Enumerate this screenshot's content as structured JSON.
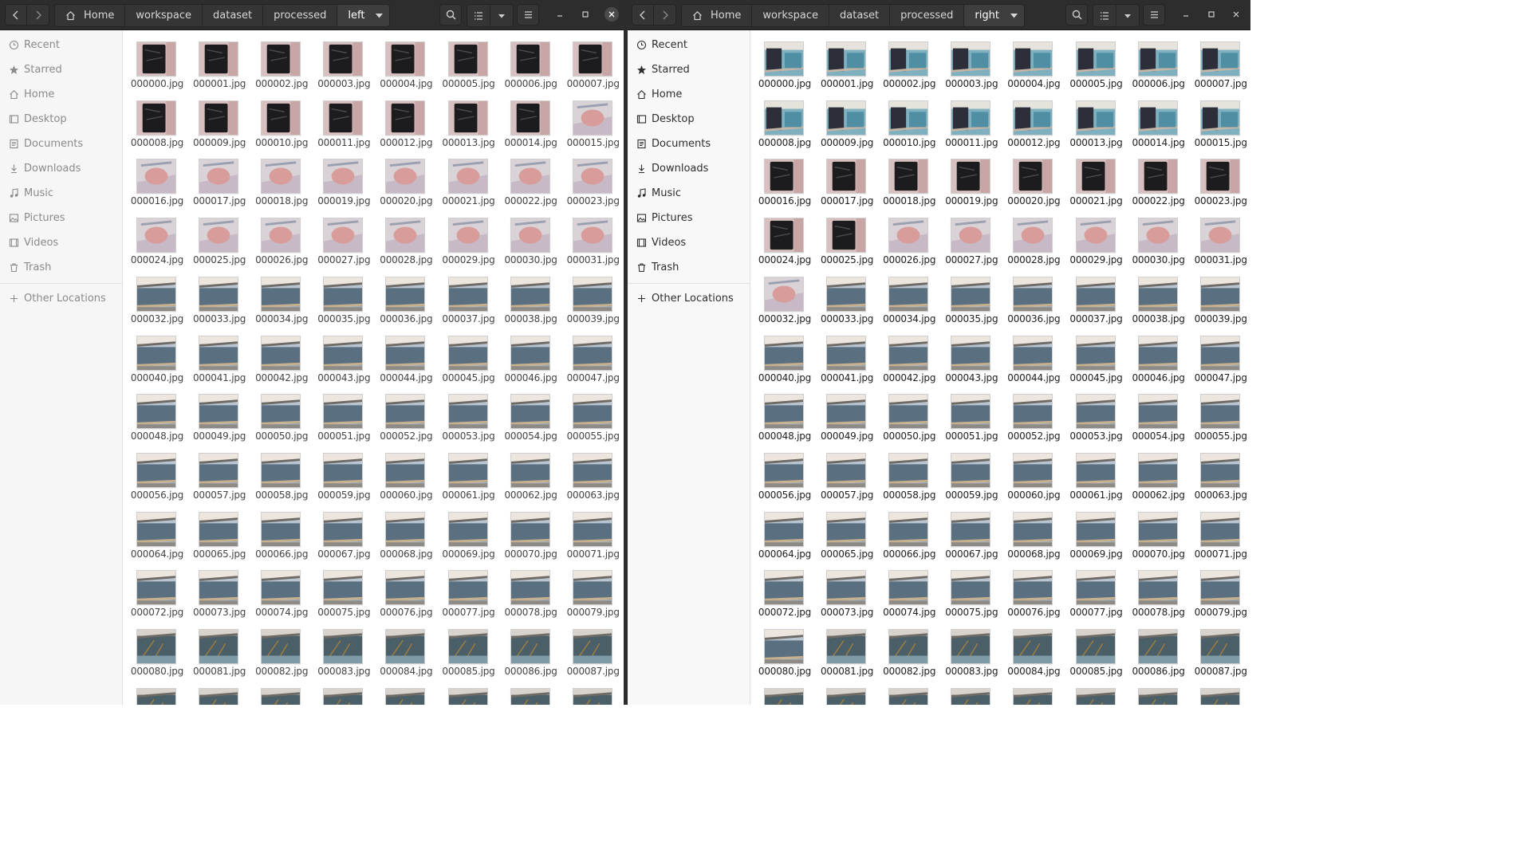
{
  "left_window": {
    "path": [
      "Home",
      "workspace",
      "dataset",
      "processed",
      "left"
    ],
    "sidebar": [
      "Recent",
      "Starred",
      "Home",
      "Desktop",
      "Documents",
      "Downloads",
      "Music",
      "Pictures",
      "Videos",
      "Trash"
    ],
    "other_locations": "Other Locations",
    "thumb_sequence": [
      "dark",
      "dark",
      "dark",
      "dark",
      "dark",
      "dark",
      "dark",
      "dark",
      "dark",
      "dark",
      "dark",
      "dark",
      "dark",
      "dark",
      "dark",
      "pink",
      "pink",
      "pink",
      "pink",
      "pink",
      "pink",
      "pink",
      "pink",
      "pink",
      "pink",
      "pink",
      "pink",
      "pink",
      "pink",
      "pink",
      "pink",
      "pink",
      "bridge",
      "bridge",
      "bridge",
      "bridge",
      "bridge",
      "bridge",
      "bridge",
      "bridge",
      "bridge",
      "bridge",
      "bridge",
      "bridge",
      "bridge",
      "bridge",
      "bridge",
      "bridge",
      "bridge",
      "bridge",
      "bridge",
      "bridge",
      "bridge",
      "bridge",
      "bridge",
      "bridge",
      "bridge",
      "bridge",
      "bridge",
      "bridge",
      "bridge",
      "bridge",
      "bridge",
      "bridge",
      "bridge",
      "bridge",
      "bridge",
      "bridge",
      "bridge",
      "bridge",
      "bridge",
      "bridge",
      "bridge",
      "bridge",
      "bridge",
      "bridge",
      "bridge",
      "bridge",
      "bridge",
      "bridge",
      "dock",
      "dock",
      "dock",
      "dock",
      "dock",
      "dock",
      "dock",
      "dock",
      "dock",
      "dock",
      "dock",
      "dock",
      "dock",
      "dock",
      "dock",
      "dock"
    ],
    "files": [
      "000000.jpg",
      "000001.jpg",
      "000002.jpg",
      "000003.jpg",
      "000004.jpg",
      "000005.jpg",
      "000006.jpg",
      "000007.jpg",
      "000008.jpg",
      "000009.jpg",
      "000010.jpg",
      "000011.jpg",
      "000012.jpg",
      "000013.jpg",
      "000014.jpg",
      "000015.jpg",
      "000016.jpg",
      "000017.jpg",
      "000018.jpg",
      "000019.jpg",
      "000020.jpg",
      "000021.jpg",
      "000022.jpg",
      "000023.jpg",
      "000024.jpg",
      "000025.jpg",
      "000026.jpg",
      "000027.jpg",
      "000028.jpg",
      "000029.jpg",
      "000030.jpg",
      "000031.jpg",
      "000032.jpg",
      "000033.jpg",
      "000034.jpg",
      "000035.jpg",
      "000036.jpg",
      "000037.jpg",
      "000038.jpg",
      "000039.jpg",
      "000040.jpg",
      "000041.jpg",
      "000042.jpg",
      "000043.jpg",
      "000044.jpg",
      "000045.jpg",
      "000046.jpg",
      "000047.jpg",
      "000048.jpg",
      "000049.jpg",
      "000050.jpg",
      "000051.jpg",
      "000052.jpg",
      "000053.jpg",
      "000054.jpg",
      "000055.jpg",
      "000056.jpg",
      "000057.jpg",
      "000058.jpg",
      "000059.jpg",
      "000060.jpg",
      "000061.jpg",
      "000062.jpg",
      "000063.jpg",
      "000064.jpg",
      "000065.jpg",
      "000066.jpg",
      "000067.jpg",
      "000068.jpg",
      "000069.jpg",
      "000070.jpg",
      "000071.jpg",
      "000072.jpg",
      "000073.jpg",
      "000074.jpg",
      "000075.jpg",
      "000076.jpg",
      "000077.jpg",
      "000078.jpg",
      "000079.jpg",
      "000080.jpg",
      "000081.jpg",
      "000082.jpg",
      "000083.jpg",
      "000084.jpg",
      "000085.jpg",
      "000086.jpg",
      "000087.jpg",
      "",
      "",
      "",
      "",
      "",
      "",
      "",
      ""
    ]
  },
  "right_window": {
    "path": [
      "Home",
      "workspace",
      "dataset",
      "processed",
      "right"
    ],
    "sidebar": [
      "Recent",
      "Starred",
      "Home",
      "Desktop",
      "Documents",
      "Downloads",
      "Music",
      "Pictures",
      "Videos",
      "Trash"
    ],
    "other_locations": "Other Locations",
    "thumb_sequence": [
      "pool",
      "pool",
      "pool",
      "pool",
      "pool",
      "pool",
      "pool",
      "pool",
      "pool",
      "pool",
      "pool",
      "pool",
      "pool",
      "pool",
      "pool",
      "pool",
      "dark",
      "dark",
      "dark",
      "dark",
      "dark",
      "dark",
      "dark",
      "dark",
      "dark",
      "dark",
      "pink",
      "pink",
      "pink",
      "pink",
      "pink",
      "pink",
      "pink",
      "bridge",
      "bridge",
      "bridge",
      "bridge",
      "bridge",
      "bridge",
      "bridge",
      "bridge",
      "bridge",
      "bridge",
      "bridge",
      "bridge",
      "bridge",
      "bridge",
      "bridge",
      "bridge",
      "bridge",
      "bridge",
      "bridge",
      "bridge",
      "bridge",
      "bridge",
      "bridge",
      "bridge",
      "bridge",
      "bridge",
      "bridge",
      "bridge",
      "bridge",
      "bridge",
      "bridge",
      "bridge",
      "bridge",
      "bridge",
      "bridge",
      "bridge",
      "bridge",
      "bridge",
      "bridge",
      "bridge",
      "bridge",
      "bridge",
      "bridge",
      "bridge",
      "bridge",
      "bridge",
      "bridge",
      "bridge",
      "dock",
      "dock",
      "dock",
      "dock",
      "dock",
      "dock",
      "dock",
      "dock",
      "dock",
      "dock",
      "dock",
      "dock",
      "dock",
      "dock",
      "dock",
      "dock"
    ],
    "files": [
      "000000.jpg",
      "000001.jpg",
      "000002.jpg",
      "000003.jpg",
      "000004.jpg",
      "000005.jpg",
      "000006.jpg",
      "000007.jpg",
      "000008.jpg",
      "000009.jpg",
      "000010.jpg",
      "000011.jpg",
      "000012.jpg",
      "000013.jpg",
      "000014.jpg",
      "000015.jpg",
      "000016.jpg",
      "000017.jpg",
      "000018.jpg",
      "000019.jpg",
      "000020.jpg",
      "000021.jpg",
      "000022.jpg",
      "000023.jpg",
      "000024.jpg",
      "000025.jpg",
      "000026.jpg",
      "000027.jpg",
      "000028.jpg",
      "000029.jpg",
      "000030.jpg",
      "000031.jpg",
      "000032.jpg",
      "000033.jpg",
      "000034.jpg",
      "000035.jpg",
      "000036.jpg",
      "000037.jpg",
      "000038.jpg",
      "000039.jpg",
      "000040.jpg",
      "000041.jpg",
      "000042.jpg",
      "000043.jpg",
      "000044.jpg",
      "000045.jpg",
      "000046.jpg",
      "000047.jpg",
      "000048.jpg",
      "000049.jpg",
      "000050.jpg",
      "000051.jpg",
      "000052.jpg",
      "000053.jpg",
      "000054.jpg",
      "000055.jpg",
      "000056.jpg",
      "000057.jpg",
      "000058.jpg",
      "000059.jpg",
      "000060.jpg",
      "000061.jpg",
      "000062.jpg",
      "000063.jpg",
      "000064.jpg",
      "000065.jpg",
      "000066.jpg",
      "000067.jpg",
      "000068.jpg",
      "000069.jpg",
      "000070.jpg",
      "000071.jpg",
      "000072.jpg",
      "000073.jpg",
      "000074.jpg",
      "000075.jpg",
      "000076.jpg",
      "000077.jpg",
      "000078.jpg",
      "000079.jpg",
      "000080.jpg",
      "000081.jpg",
      "000082.jpg",
      "000083.jpg",
      "000084.jpg",
      "000085.jpg",
      "000086.jpg",
      "000087.jpg",
      "",
      "",
      "",
      "",
      "",
      "",
      "",
      ""
    ]
  },
  "icons": {
    "sidebar": [
      "clock-icon",
      "star-icon",
      "home-icon",
      "desktop-icon",
      "documents-icon",
      "downloads-icon",
      "music-icon",
      "pictures-icon",
      "videos-icon",
      "trash-icon"
    ],
    "other_locations": "plus-icon",
    "toolbar": [
      "back-icon",
      "forward-icon",
      "home-icon",
      "dropdown-icon",
      "search-icon",
      "list-view-icon",
      "dropdown-icon",
      "menu-icon",
      "minimize-icon",
      "maximize-icon",
      "close-icon"
    ]
  },
  "colors": {
    "headerbar": "#2d2d2d",
    "sidebar_bg": "#f6f6f6",
    "content_bg": "#ffffff"
  }
}
